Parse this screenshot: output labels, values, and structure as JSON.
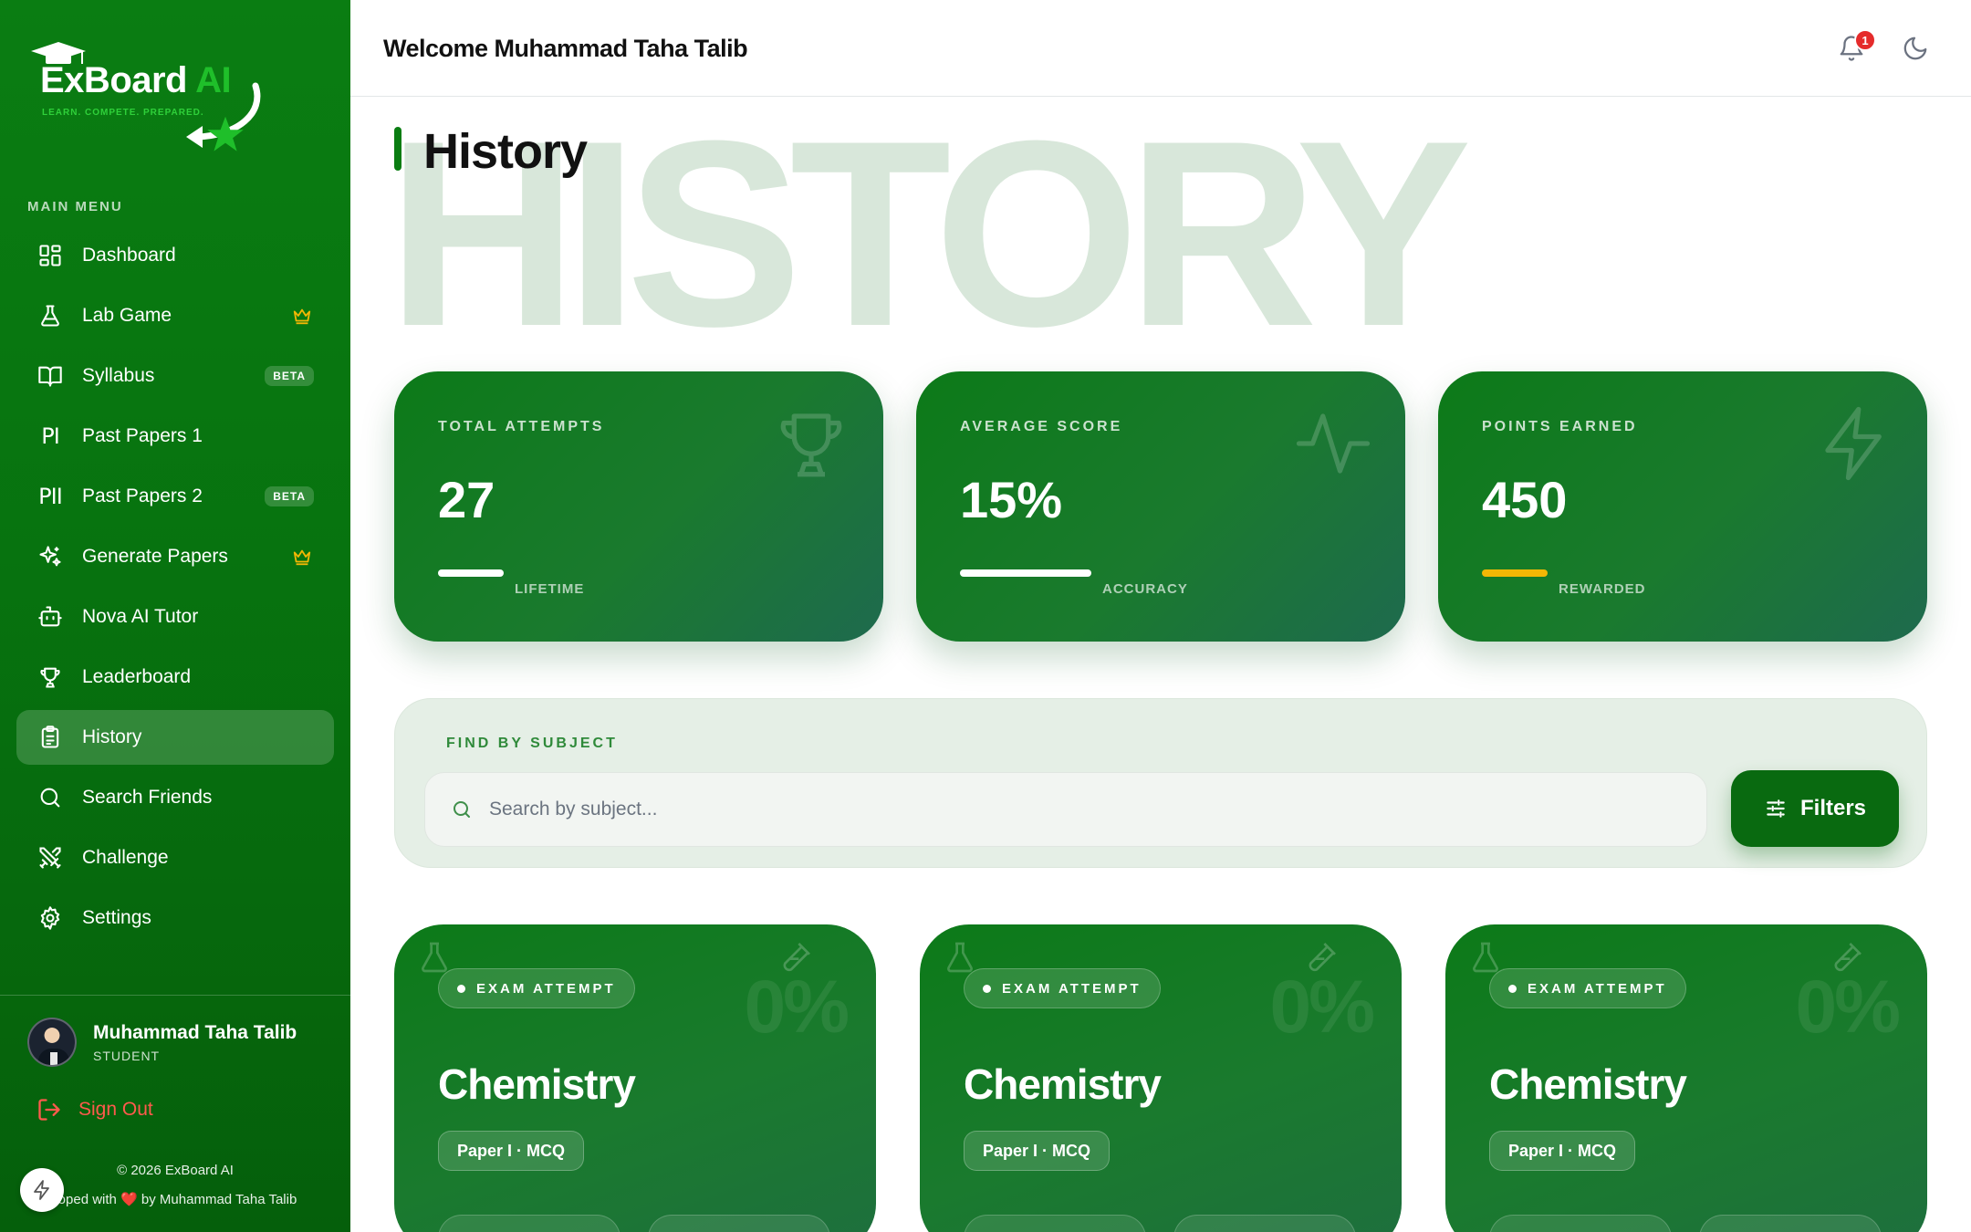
{
  "app": {
    "brand_main": "ExBoard",
    "brand_accent": " AI",
    "tagline": "LEARN. COMPETE. PREPARED."
  },
  "sidebar": {
    "menu_title": "MAIN MENU",
    "items": [
      {
        "label": "Dashboard",
        "icon": "dashboard-icon"
      },
      {
        "label": "Lab Game",
        "icon": "flask-icon",
        "badge": "crown"
      },
      {
        "label": "Syllabus",
        "icon": "book-icon",
        "badge": "BETA"
      },
      {
        "label": "Past Papers 1",
        "icon": "pi-icon",
        "icon_text": "PI"
      },
      {
        "label": "Past Papers 2",
        "icon": "pii-icon",
        "icon_text": "PII",
        "badge": "BETA"
      },
      {
        "label": "Generate Papers",
        "icon": "sparkles-icon",
        "badge": "crown"
      },
      {
        "label": "Nova AI Tutor",
        "icon": "bot-icon"
      },
      {
        "label": "Leaderboard",
        "icon": "trophy-icon"
      },
      {
        "label": "History",
        "icon": "clipboard-icon",
        "active": true
      },
      {
        "label": "Search Friends",
        "icon": "search-icon"
      },
      {
        "label": "Challenge",
        "icon": "swords-icon"
      },
      {
        "label": "Settings",
        "icon": "gear-icon"
      }
    ],
    "profile": {
      "name": "Muhammad Taha Talib",
      "role": "STUDENT"
    },
    "signout_label": "Sign Out",
    "copyright": "© 2026 ExBoard AI",
    "dev_prefix": "eloped with ",
    "dev_suffix": " by Muhammad Taha Talib"
  },
  "header": {
    "welcome": "Welcome Muhammad Taha Talib",
    "notification_count": "1"
  },
  "page": {
    "bg_word": "HISTORY",
    "title": "History"
  },
  "stats": [
    {
      "label": "TOTAL ATTEMPTS",
      "value": "27",
      "foot": "LIFETIME",
      "icon": "trophy-icon"
    },
    {
      "label": "AVERAGE SCORE",
      "value": "15%",
      "foot": "ACCURACY",
      "icon": "activity-icon"
    },
    {
      "label": "POINTS EARNED",
      "value": "450",
      "foot": "REWARDED",
      "icon": "bolt-icon"
    }
  ],
  "search": {
    "label": "FIND BY SUBJECT",
    "placeholder": "Search by subject...",
    "filters_label": "Filters"
  },
  "attempts": [
    {
      "tag": "EXAM ATTEMPT",
      "subject": "Chemistry",
      "paper": "Paper I · MCQ",
      "score": "0%"
    },
    {
      "tag": "EXAM ATTEMPT",
      "subject": "Chemistry",
      "paper": "Paper I · MCQ",
      "score": "0%"
    },
    {
      "tag": "EXAM ATTEMPT",
      "subject": "Chemistry",
      "paper": "Paper I · MCQ",
      "score": "0%"
    }
  ],
  "colors": {
    "sidebar_green": "#0a7d12",
    "accent_gold": "#f2b705",
    "danger": "#ff5a4d",
    "watermark": "#d8e7da"
  }
}
